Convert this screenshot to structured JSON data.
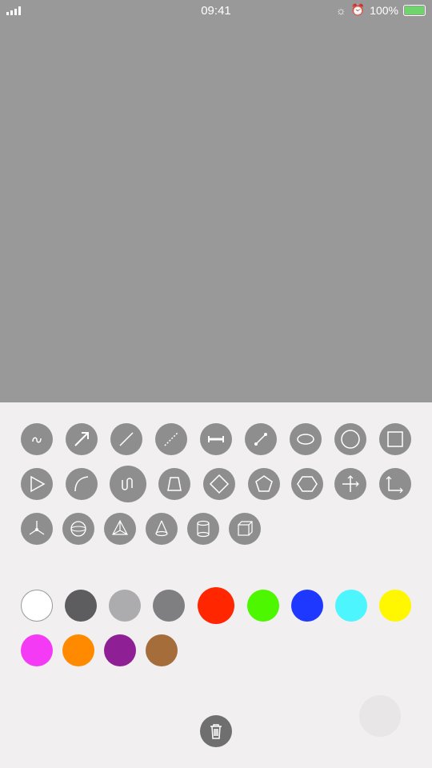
{
  "status": {
    "time": "09:41",
    "battery": "100%"
  },
  "tools": [
    {
      "name": "freehand-icon"
    },
    {
      "name": "arrow-icon"
    },
    {
      "name": "line-icon"
    },
    {
      "name": "dashed-line-icon"
    },
    {
      "name": "double-arrow-icon"
    },
    {
      "name": "segment-icon"
    },
    {
      "name": "ellipse-icon"
    },
    {
      "name": "circle-icon"
    },
    {
      "name": "square-icon"
    },
    {
      "name": "triangle-icon"
    },
    {
      "name": "arc-icon"
    },
    {
      "name": "wave-icon"
    },
    {
      "name": "trapezoid-icon"
    },
    {
      "name": "diamond-icon"
    },
    {
      "name": "pentagon-icon"
    },
    {
      "name": "hexagon-icon"
    },
    {
      "name": "cross-axis-icon"
    },
    {
      "name": "angle-axis-icon"
    },
    {
      "name": "3d-axis-icon"
    },
    {
      "name": "sphere-icon"
    },
    {
      "name": "pyramid-icon"
    },
    {
      "name": "cone-icon"
    },
    {
      "name": "cylinder-icon"
    },
    {
      "name": "cube-icon"
    }
  ],
  "colors": [
    "#ffffff",
    "#5d5d60",
    "#acacae",
    "#7f7f82",
    "#ff2600",
    "#4cf700",
    "#1e38ff",
    "#4df5ff",
    "#fff700",
    "#f53af5",
    "#ff8a00",
    "#8e1f94",
    "#a46d3a"
  ],
  "trash": {
    "icon": "trash-icon"
  }
}
